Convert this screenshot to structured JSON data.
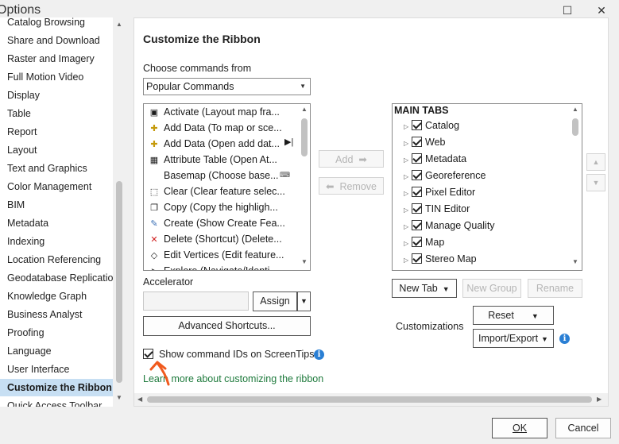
{
  "window": {
    "title": "Options"
  },
  "nav": {
    "items": [
      "Catalog Browsing",
      "Share and Download",
      "Raster and Imagery",
      "Full Motion Video",
      "Display",
      "Table",
      "Report",
      "Layout",
      "Text and Graphics",
      "Color Management",
      "BIM",
      "Metadata",
      "Indexing",
      "Location Referencing",
      "Geodatabase Replication",
      "Knowledge Graph",
      "Business Analyst",
      "Proofing",
      "Language",
      "User Interface",
      "Customize the Ribbon",
      "Quick Access Toolbar"
    ],
    "selected": "Customize the Ribbon"
  },
  "main": {
    "heading": "Customize the Ribbon",
    "choose_label": "Choose commands from",
    "choose_value": "Popular Commands",
    "commands": [
      {
        "label": "Activate (Layout map fra...",
        "icon": "activate-icon"
      },
      {
        "label": "Add Data (To map or sce...",
        "icon": "add-data-icon"
      },
      {
        "label": "Add Data (Open add dat...",
        "icon": "add-data-icon"
      },
      {
        "label": "Attribute Table (Open At...",
        "icon": "table-icon"
      },
      {
        "label": "Basemap (Choose base...",
        "icon": "basemap-icon"
      },
      {
        "label": "Clear (Clear feature selec...",
        "icon": "clear-icon"
      },
      {
        "label": "Copy (Copy the highligh...",
        "icon": "copy-icon"
      },
      {
        "label": "Create (Show Create Fea...",
        "icon": "create-icon"
      },
      {
        "label": "Delete (Shortcut) (Delete...",
        "icon": "delete-icon"
      },
      {
        "label": "Edit Vertices (Edit feature...",
        "icon": "edit-vertices-icon"
      },
      {
        "label": "Explore (Navigate/Identi...",
        "icon": "explore-icon"
      }
    ],
    "add_label": "Add",
    "remove_label": "Remove",
    "tree_header": "MAIN TABS",
    "tabs": [
      "Catalog",
      "Web",
      "Metadata",
      "Georeference",
      "Pixel Editor",
      "TIN Editor",
      "Manage Quality",
      "Map",
      "Stereo Map"
    ],
    "new_tab_label": "New Tab",
    "new_group_label": "New Group",
    "rename_label": "Rename",
    "accelerator_label": "Accelerator",
    "accelerator_value": "",
    "assign_label": "Assign",
    "advanced_label": "Advanced Shortcuts...",
    "customizations_label": "Customizations",
    "reset_label": "Reset",
    "import_export_label": "Import/Export",
    "show_ids_label": "Show command IDs on ScreenTips",
    "show_ids_checked": true,
    "learn_link": "Learn more about customizing the ribbon"
  },
  "footer": {
    "ok_label": "OK",
    "cancel_label": "Cancel"
  },
  "colors": {
    "selection": "#c7dff3",
    "link": "#1e7a3c",
    "info": "#2a7fd4",
    "annotation": "#f05a1e"
  }
}
